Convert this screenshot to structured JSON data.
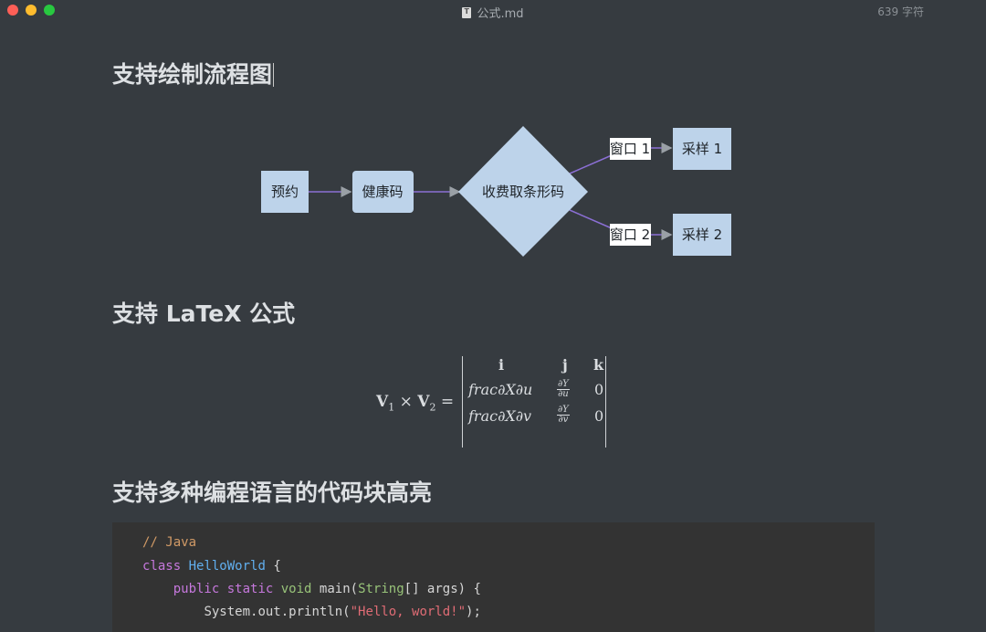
{
  "window": {
    "file_name": "公式.md",
    "word_count": "639 字符"
  },
  "sections": {
    "flowchart_heading": "支持绘制流程图",
    "latex_heading": "支持 LaTeX 公式",
    "code_heading": "支持多种编程语言的代码块高亮"
  },
  "flowchart": {
    "nodes": {
      "reserve": "预约",
      "health_code": "健康码",
      "fee_barcode": "收费取条形码",
      "window1": "窗口 1",
      "window2": "窗口 2",
      "sample1": "采样 1",
      "sample2": "采样 2"
    },
    "colors": {
      "node_fill": "#bdd3ea",
      "edge": "#8b6fd4"
    }
  },
  "formula": {
    "lhs_v1": "V",
    "lhs_sub1": "1",
    "lhs_times": "×",
    "lhs_v2": "V",
    "lhs_sub2": "2",
    "lhs_eq": "=",
    "row1": [
      "i",
      "j",
      "k"
    ],
    "row2_a": "frac∂X∂u",
    "row2_frac_num": "∂Y",
    "row2_frac_den": "∂u",
    "row2_c": "0",
    "row3_a": "frac∂X∂v",
    "row3_frac_num": "∂Y",
    "row3_frac_den": "∂v",
    "row3_c": "0"
  },
  "code": {
    "language_comment": "// Java",
    "line2_kw": "class",
    "line2_name": "HelloWorld",
    "line2_brace": " {",
    "line3_indent": "    ",
    "line3_kw1": "public",
    "line3_kw2": "static",
    "line3_kw3": "void",
    "line3_name": "main(",
    "line3_type": "String",
    "line3_rest": "[] args) {",
    "line4_indent": "        ",
    "line4_call": "System.out.println(",
    "line4_str": "\"Hello, world!\"",
    "line4_end": ");"
  }
}
